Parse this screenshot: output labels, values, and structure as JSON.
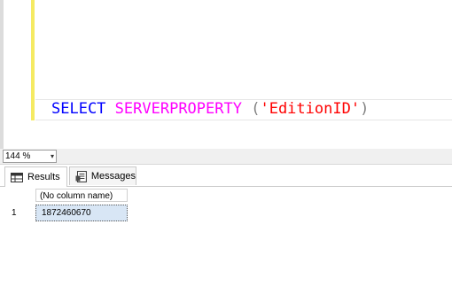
{
  "editor": {
    "sql": {
      "keyword": "SELECT",
      "function": "SERVERPROPERTY",
      "open_paren": "(",
      "string": "'EditionID'",
      "close_paren": ")"
    }
  },
  "zoom": {
    "value": "144 %",
    "arrow": "▾"
  },
  "tabs": [
    {
      "label": "Results",
      "icon": "grid-icon",
      "selected": true
    },
    {
      "label": "Messages",
      "icon": "messages-icon",
      "selected": false
    }
  ],
  "results": {
    "columns": [
      "(No column name)"
    ],
    "rows": [
      {
        "row_number": "1",
        "values": [
          "1872460670"
        ]
      }
    ]
  },
  "colors": {
    "keyword": "#0000ff",
    "function": "#ff00ff",
    "string": "#ff0000",
    "change_bar": "#f5ea62",
    "selected_cell": "#d8e6f5"
  }
}
